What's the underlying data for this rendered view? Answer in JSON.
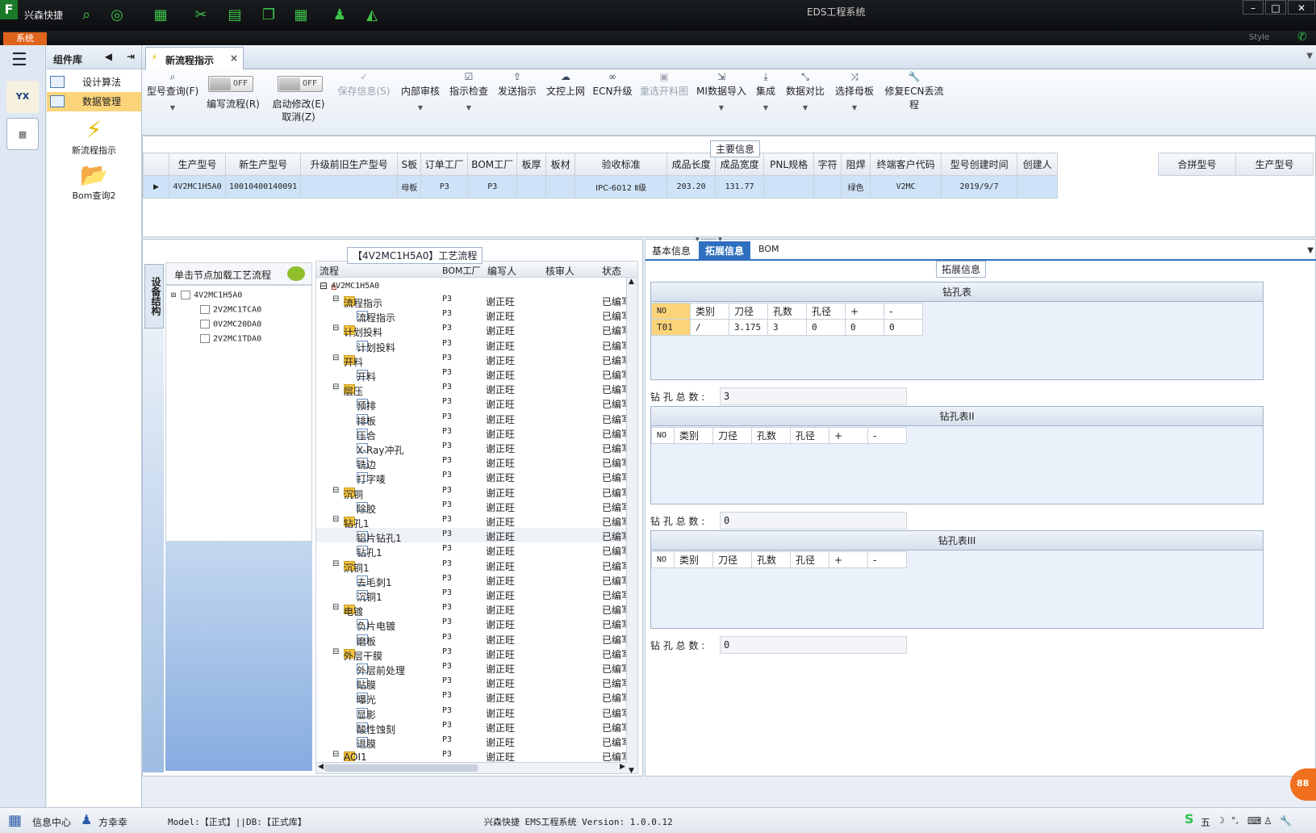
{
  "titlebar": {
    "app_name": "兴森快捷",
    "window_title": "EDS工程系统",
    "system_button": "系统",
    "style_label": "Style"
  },
  "components": {
    "header": "组件库",
    "items": [
      "设计算法",
      "数据管理"
    ],
    "big_items": [
      "新流程指示",
      "Bom查询2"
    ]
  },
  "tab": {
    "label": "新流程指示",
    "close": "×"
  },
  "ribbon": {
    "buttons": [
      {
        "label": "型号查询(F)",
        "icon": "search-icon",
        "dropdown": true
      },
      {
        "label": "保存信息(S)",
        "icon": "check-icon",
        "disabled": true
      },
      {
        "label": "内部审核",
        "dropdown": true
      },
      {
        "label": "指示检查",
        "icon": "checkbox-icon",
        "dropdown": true
      },
      {
        "label": "发送指示",
        "icon": "upload-icon"
      },
      {
        "label": "文控上网",
        "icon": "cloud-icon"
      },
      {
        "label": "ECN升级",
        "icon": "binoculars-icon"
      },
      {
        "label": "重选开料图",
        "icon": "image-icon",
        "disabled": true
      },
      {
        "label": "MI数据导入",
        "icon": "import-icon",
        "dropdown": true
      },
      {
        "label": "集成",
        "icon": "download-icon",
        "dropdown": true
      },
      {
        "label": "数据对比",
        "icon": "compare-icon",
        "dropdown": true
      },
      {
        "label": "选择母板",
        "icon": "shuffle-icon",
        "dropdown": true
      },
      {
        "label": "修复ECN丢流程",
        "icon": "wrench-icon"
      }
    ],
    "toggle_write": {
      "label": "编写流程(R)",
      "state": "OFF"
    },
    "toggle_modify": {
      "label": "启动修改(E)",
      "sub": "取消(Z)",
      "state": "OFF"
    }
  },
  "main_info": {
    "caption": "主要信息",
    "columns": [
      "生产型号",
      "新生产型号",
      "升级前旧生产型号",
      "S板",
      "订单工厂",
      "BOM工厂",
      "板厚",
      "板材",
      "验收标准",
      "成品长度",
      "成品宽度",
      "PNL规格",
      "字符",
      "阻焊",
      "终端客户代码",
      "型号创建时间",
      "创建人"
    ],
    "row": [
      "4V2MC1H5A0",
      "10010400140091",
      "",
      "母板",
      "P3",
      "P3",
      "",
      "",
      "IPC-6012 Ⅱ级",
      "203.20",
      "131.77",
      "",
      "",
      "绿色",
      "V2MC",
      "2019/9/7",
      ""
    ],
    "side_columns": [
      "合拼型号",
      "生产型号"
    ]
  },
  "process": {
    "caption": "【4V2MC1H5A0】工艺流程",
    "vertical_tab": "设备结构",
    "load_hint": "单击节点加载工艺流程",
    "part_tree": [
      "4V2MC1H5A0",
      "2V2MC1TCA0",
      "0V2MC20DA0",
      "2V2MC1TDA0"
    ],
    "columns": [
      "流程",
      "BOM工厂",
      "编写人",
      "核审人",
      "状态"
    ],
    "root": "4V2MC1H5A0",
    "rows": [
      {
        "n": "流程指示",
        "lvl": 1,
        "t": "fold"
      },
      {
        "n": "流程指示",
        "lvl": 2,
        "t": "doc"
      },
      {
        "n": "计划投料",
        "lvl": 1,
        "t": "fold"
      },
      {
        "n": "计划投料",
        "lvl": 2,
        "t": "doc"
      },
      {
        "n": "开料",
        "lvl": 1,
        "t": "fold"
      },
      {
        "n": "开料",
        "lvl": 2,
        "t": "doc"
      },
      {
        "n": "层压",
        "lvl": 1,
        "t": "fold"
      },
      {
        "n": "预排",
        "lvl": 2,
        "t": "doc"
      },
      {
        "n": "排板",
        "lvl": 2,
        "t": "doc"
      },
      {
        "n": "压合",
        "lvl": 2,
        "t": "doc"
      },
      {
        "n": "X-Ray冲孔",
        "lvl": 2,
        "t": "doc"
      },
      {
        "n": "铣边",
        "lvl": 2,
        "t": "doc"
      },
      {
        "n": "打字唛",
        "lvl": 2,
        "t": "doc"
      },
      {
        "n": "沉铜",
        "lvl": 1,
        "t": "fold"
      },
      {
        "n": "除胶",
        "lvl": 2,
        "t": "doc"
      },
      {
        "n": "钻孔1",
        "lvl": 1,
        "t": "fold"
      },
      {
        "n": "铝片钻孔1",
        "lvl": 2,
        "t": "doc",
        "sel": true
      },
      {
        "n": "钻孔1",
        "lvl": 2,
        "t": "doc"
      },
      {
        "n": "沉铜1",
        "lvl": 1,
        "t": "fold"
      },
      {
        "n": "去毛刺1",
        "lvl": 2,
        "t": "doc"
      },
      {
        "n": "沉铜1",
        "lvl": 2,
        "t": "doc"
      },
      {
        "n": "电镀",
        "lvl": 1,
        "t": "fold"
      },
      {
        "n": "负片电镀",
        "lvl": 2,
        "t": "doc"
      },
      {
        "n": "磨板",
        "lvl": 2,
        "t": "doc"
      },
      {
        "n": "外层干膜",
        "lvl": 1,
        "t": "fold"
      },
      {
        "n": "外层前处理",
        "lvl": 2,
        "t": "doc"
      },
      {
        "n": "贴膜",
        "lvl": 2,
        "t": "doc"
      },
      {
        "n": "曝光",
        "lvl": 2,
        "t": "doc"
      },
      {
        "n": "显影",
        "lvl": 2,
        "t": "doc"
      },
      {
        "n": "酸性蚀刻",
        "lvl": 2,
        "t": "doc"
      },
      {
        "n": "退膜",
        "lvl": 2,
        "t": "doc"
      },
      {
        "n": "AOI1",
        "lvl": 1,
        "t": "fold"
      }
    ],
    "bom": "P3",
    "writer": "谢正旺",
    "status": "已编写"
  },
  "right": {
    "tabs": [
      "基本信息",
      "拓展信息",
      "BOM"
    ],
    "caption": "拓展信息",
    "drill_headers": [
      "NO",
      "类别",
      "刀径",
      "孔数",
      "孔径",
      "+",
      "-"
    ],
    "tables": [
      {
        "title": "钻孔表",
        "rows": [
          [
            "T01",
            "/",
            "3.175",
            "3",
            "0",
            "0",
            "0"
          ]
        ],
        "total_label": "钻 孔 总 数 :",
        "total": "3"
      },
      {
        "title": "钻孔表II",
        "rows": [],
        "total_label": "钻 孔 总 数 :",
        "total": "0"
      },
      {
        "title": "钻孔表III",
        "rows": [],
        "total_label": "钻 孔 总 数 :",
        "total": "0"
      }
    ]
  },
  "status": {
    "info_center": "信息中心",
    "user": "方幸幸",
    "model": "Model:【正式】||DB:【正式库】",
    "version": "兴森快捷 EMS工程系统 Version: 1.0.0.12",
    "ime": "五",
    "badge": "88"
  }
}
